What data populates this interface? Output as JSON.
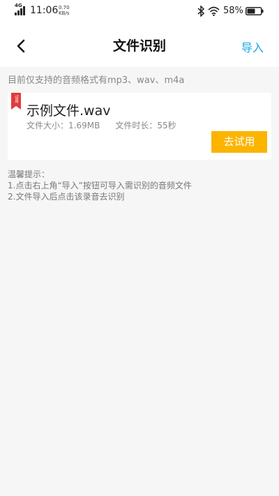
{
  "status_bar": {
    "network": "4G",
    "time": "11:06",
    "speed_value": "0.70",
    "speed_unit": "KB/s",
    "battery_percent": "58%",
    "battery_level": 0.58,
    "icons": [
      "signal-icon",
      "bluetooth-icon",
      "wifi-icon",
      "battery-icon"
    ]
  },
  "header": {
    "title": "文件识别",
    "import_label": "导入",
    "accent_color": "#1aa7e8"
  },
  "format_note": "目前仅支持的音频格式有mp3、wav、m4a",
  "sample_file": {
    "badge": "试用",
    "name": "示例文件.wav",
    "size_text": "文件大小：1.69MB",
    "duration_text": "文件时长：55秒",
    "action_label": "去试用",
    "action_color": "#fbb400"
  },
  "tips": {
    "title": "温馨提示：",
    "items": [
      "1.点击右上角“导入”按钮可导入需识别的音频文件",
      "2.文件导入后点击该录音去识别"
    ]
  }
}
